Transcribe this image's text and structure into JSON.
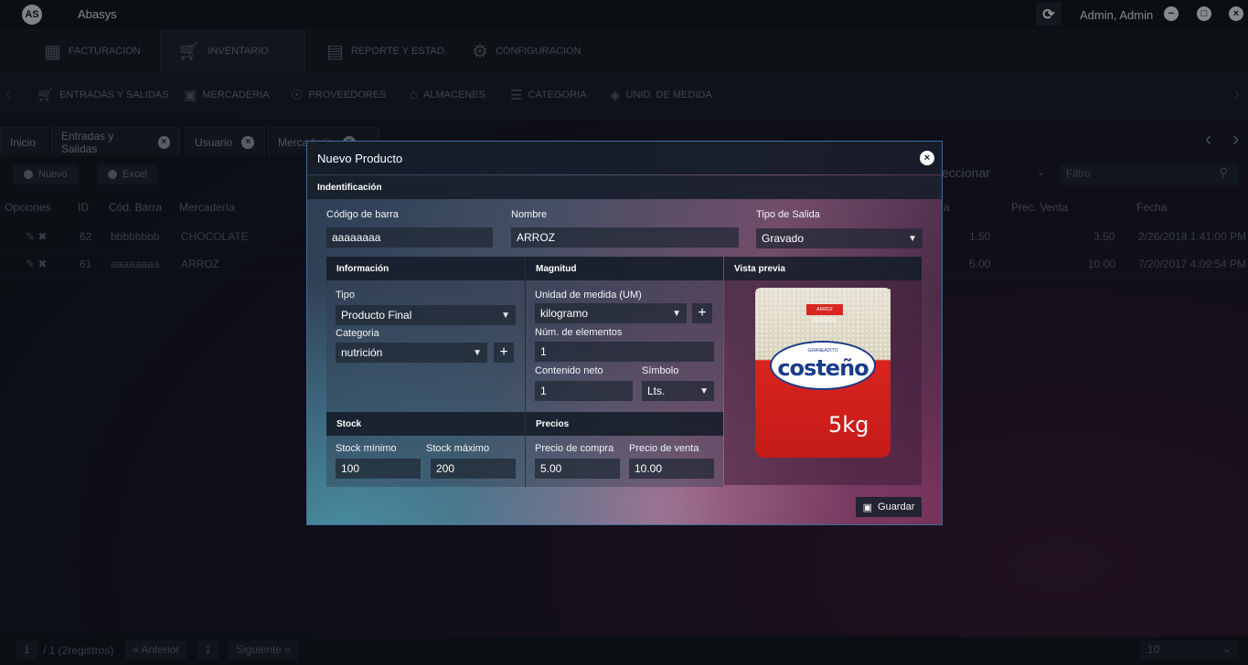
{
  "titlebar": {
    "logo": "AS",
    "app_title": "Abasys",
    "user": "Admin, Admin"
  },
  "main_tabs": [
    {
      "label": "FACTURACION",
      "icon": "calculator-icon"
    },
    {
      "label": "INVENTARIO",
      "icon": "cart-icon"
    },
    {
      "label": "REPORTE Y ESTAD.",
      "icon": "report-icon"
    },
    {
      "label": "CONFIGURACION",
      "icon": "gear-icon"
    }
  ],
  "sub_nav": [
    {
      "label": "ENTRADAS Y SALIDAS",
      "icon": "cart-icon"
    },
    {
      "label": "MERCADERIA",
      "icon": "box-icon"
    },
    {
      "label": "PROVEEDORES",
      "icon": "handshake-icon"
    },
    {
      "label": "ALMACENES",
      "icon": "warehouse-icon"
    },
    {
      "label": "CATEGORIA",
      "icon": "list-icon"
    },
    {
      "label": "UNID. DE MEDIDA",
      "icon": "cube-icon"
    }
  ],
  "doc_tabs": [
    "Inicio",
    "Entradas y Salidas",
    "Usuario",
    "Mercadería"
  ],
  "toolbar": {
    "new_label": "Nuevo",
    "excel_label": "Excel",
    "select_placeholder": "eccionar",
    "filter_placeholder": "Filtro"
  },
  "grid": {
    "headers": {
      "opciones": "Opciones",
      "id": "ID",
      "barcode": "Cód. Barra",
      "merch": "Mercadería",
      "price_buy_tail": "a",
      "price_sell": "Prec. Venta",
      "date": "Fecha"
    },
    "rows": [
      {
        "id": "62",
        "barcode": "bbbbbbbb",
        "merch": "CHOCOLATE",
        "price_buy": "1.50",
        "price_sell": "3.50",
        "date": "2/26/2018 1:41:00 PM"
      },
      {
        "id": "61",
        "barcode": "aaaaaaaa",
        "merch": "ARROZ",
        "price_buy": "5.00",
        "price_sell": "10.00",
        "date": "7/20/2017 4:09:54 PM"
      }
    ]
  },
  "pager": {
    "page": "1",
    "total": "/ 1 (2registros)",
    "prev": "« Anterior",
    "current": "1",
    "next": "Siguiente »",
    "page_size": "10"
  },
  "modal": {
    "title": "Nuevo Producto",
    "identification": {
      "section": "Indentificación",
      "barcode_label": "Código de barra",
      "barcode_value": "aaaaaaaa",
      "name_label": "Nombre",
      "name_value": "ARROZ",
      "output_label": "Tipo de Salida",
      "output_value": "Gravado"
    },
    "info": {
      "section": "Información",
      "type_label": "Tipo",
      "type_value": "Producto Final",
      "category_label": "Categoria",
      "category_value": "nutrición"
    },
    "magnitude": {
      "section": "Magnitud",
      "unit_label": "Unidad de medida (UM)",
      "unit_value": "kilogramo",
      "count_label": "Núm. de elementos",
      "count_value": "1",
      "content_label": "Contenido neto",
      "content_value": "1",
      "symbol_label": "Símbolo",
      "symbol_value": "Lts."
    },
    "preview": {
      "section": "Vista previa",
      "brand": "costeño",
      "sub": "GRANEADITO",
      "tag": "ARROZ SUPERIOR",
      "weight": "5kg"
    },
    "stock": {
      "section": "Stock",
      "min_label": "Stock mínimo",
      "min_value": "100",
      "max_label": "Stock máximo",
      "max_value": "200"
    },
    "prices": {
      "section": "Precios",
      "buy_label": "Precio de compra",
      "buy_value": "5.00",
      "sell_label": "Precio de venta",
      "sell_value": "10.00"
    },
    "save_label": "Guardar"
  }
}
